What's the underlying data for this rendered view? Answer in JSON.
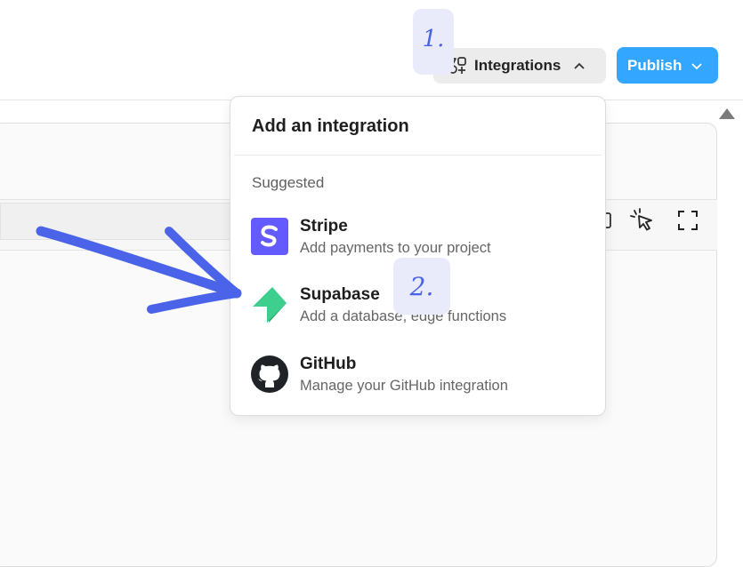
{
  "header": {
    "integrations_label": "Integrations",
    "publish_label": "Publish"
  },
  "annotations": {
    "step1": "1.",
    "step2": "2."
  },
  "dropdown": {
    "title": "Add an integration",
    "section": "Suggested",
    "items": [
      {
        "name": "Stripe",
        "description": "Add payments to your project",
        "icon": "stripe-logo",
        "color": "#635bff"
      },
      {
        "name": "Supabase",
        "description": "Add a database, edge functions",
        "icon": "supabase-logo",
        "color": "#3ecf8e"
      },
      {
        "name": "GitHub",
        "description": "Manage your GitHub integration",
        "icon": "github-logo",
        "color": "#1f2328"
      }
    ]
  },
  "colors": {
    "publish": "#33a7ff",
    "annotation": "#4a63e6",
    "arrow": "#4b63e8"
  }
}
